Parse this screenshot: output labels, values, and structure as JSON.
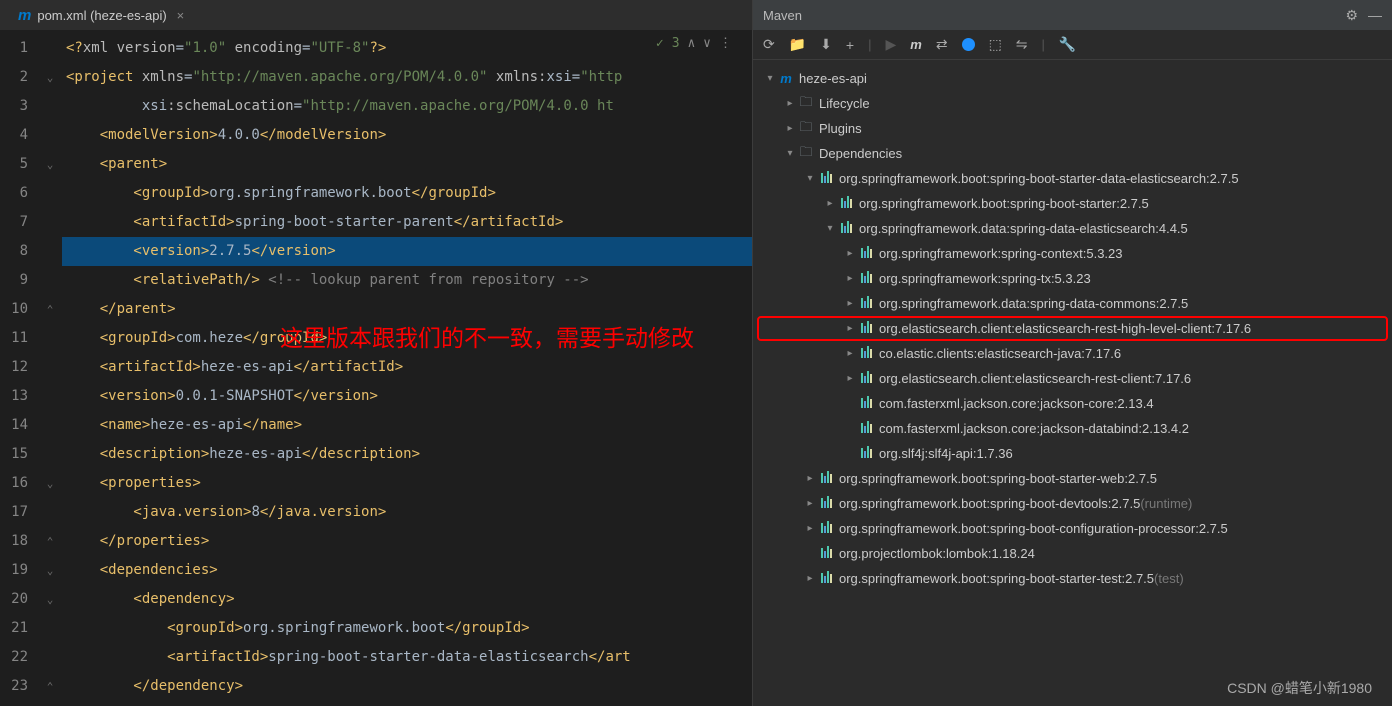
{
  "tab": {
    "icon": "m",
    "title": "pom.xml (heze-es-api)"
  },
  "analysisStatus": {
    "check": "✓",
    "count": "3",
    "arrows": "∧ ∨"
  },
  "annotation": "这里版本跟我们的不一致，需要手动修改",
  "watermark": "CSDN @蜡笔小新1980",
  "codeLines": [
    {
      "n": "1",
      "content": [
        {
          "t": "<?",
          "c": "c-punct"
        },
        {
          "t": "xml version",
          "c": "c-attr"
        },
        {
          "t": "=",
          "c": "c-txt"
        },
        {
          "t": "\"1.0\"",
          "c": "c-str"
        },
        {
          "t": " encoding",
          "c": "c-attr"
        },
        {
          "t": "=",
          "c": "c-txt"
        },
        {
          "t": "\"UTF-8\"",
          "c": "c-str"
        },
        {
          "t": "?>",
          "c": "c-punct"
        }
      ]
    },
    {
      "n": "2",
      "content": [
        {
          "t": "<project ",
          "c": "c-tag"
        },
        {
          "t": "xmlns",
          "c": "c-attr"
        },
        {
          "t": "=",
          "c": "c-txt"
        },
        {
          "t": "\"http://maven.apache.org/POM/4.0.0\"",
          "c": "c-str"
        },
        {
          "t": " xmlns:",
          "c": "c-attr"
        },
        {
          "t": "xsi",
          "c": "c-txt"
        },
        {
          "t": "=",
          "c": "c-txt"
        },
        {
          "t": "\"http",
          "c": "c-str"
        }
      ]
    },
    {
      "n": "3",
      "content": [
        {
          "t": "         xsi",
          "c": "c-txt"
        },
        {
          "t": ":schemaLocation",
          "c": "c-attr"
        },
        {
          "t": "=",
          "c": "c-txt"
        },
        {
          "t": "\"http://maven.apache.org/POM/4.0.0 ht",
          "c": "c-str"
        }
      ]
    },
    {
      "n": "4",
      "content": [
        {
          "t": "    <modelVersion>",
          "c": "c-tag"
        },
        {
          "t": "4.0.0",
          "c": "c-txt"
        },
        {
          "t": "</modelVersion>",
          "c": "c-tag"
        }
      ]
    },
    {
      "n": "5",
      "content": [
        {
          "t": "    <parent>",
          "c": "c-tag"
        }
      ]
    },
    {
      "n": "6",
      "content": [
        {
          "t": "        <groupId>",
          "c": "c-tag"
        },
        {
          "t": "org.springframework.boot",
          "c": "c-txt"
        },
        {
          "t": "</groupId>",
          "c": "c-tag"
        }
      ]
    },
    {
      "n": "7",
      "content": [
        {
          "t": "        <artifactId>",
          "c": "c-tag"
        },
        {
          "t": "spring-boot-starter-parent",
          "c": "c-txt"
        },
        {
          "t": "</artifactId>",
          "c": "c-tag"
        }
      ]
    },
    {
      "n": "8",
      "hl": true,
      "content": [
        {
          "t": "        <version>",
          "c": "c-tag"
        },
        {
          "t": "2.7.5",
          "c": "c-txt"
        },
        {
          "t": "</version>",
          "c": "c-tag"
        }
      ]
    },
    {
      "n": "9",
      "content": [
        {
          "t": "        <relativePath/> ",
          "c": "c-tag"
        },
        {
          "t": "<!-- lookup parent from repository -->",
          "c": "c-comment"
        }
      ]
    },
    {
      "n": "10",
      "content": [
        {
          "t": "    </parent>",
          "c": "c-tag"
        }
      ]
    },
    {
      "n": "11",
      "content": [
        {
          "t": "    <groupId>",
          "c": "c-tag"
        },
        {
          "t": "com.heze",
          "c": "c-txt"
        },
        {
          "t": "</groupId>",
          "c": "c-tag"
        }
      ]
    },
    {
      "n": "12",
      "content": [
        {
          "t": "    <artifactId>",
          "c": "c-tag"
        },
        {
          "t": "heze-es-api",
          "c": "c-txt"
        },
        {
          "t": "</artifactId>",
          "c": "c-tag"
        }
      ]
    },
    {
      "n": "13",
      "content": [
        {
          "t": "    <version>",
          "c": "c-tag"
        },
        {
          "t": "0.0.1-SNAPSHOT",
          "c": "c-txt"
        },
        {
          "t": "</version>",
          "c": "c-tag"
        }
      ]
    },
    {
      "n": "14",
      "content": [
        {
          "t": "    <name>",
          "c": "c-tag"
        },
        {
          "t": "heze-es-api",
          "c": "c-txt"
        },
        {
          "t": "</name>",
          "c": "c-tag"
        }
      ]
    },
    {
      "n": "15",
      "content": [
        {
          "t": "    <description>",
          "c": "c-tag"
        },
        {
          "t": "heze-es-api",
          "c": "c-txt"
        },
        {
          "t": "</description>",
          "c": "c-tag"
        }
      ]
    },
    {
      "n": "16",
      "content": [
        {
          "t": "    <properties>",
          "c": "c-tag"
        }
      ]
    },
    {
      "n": "17",
      "content": [
        {
          "t": "        <java.version>",
          "c": "c-tag"
        },
        {
          "t": "8",
          "c": "c-txt"
        },
        {
          "t": "</java.version>",
          "c": "c-tag"
        }
      ]
    },
    {
      "n": "18",
      "content": [
        {
          "t": "    </properties>",
          "c": "c-tag"
        }
      ]
    },
    {
      "n": "19",
      "content": [
        {
          "t": "    <dependencies>",
          "c": "c-tag"
        }
      ]
    },
    {
      "n": "20",
      "content": [
        {
          "t": "        <dependency>",
          "c": "c-tag"
        }
      ]
    },
    {
      "n": "21",
      "content": [
        {
          "t": "            <groupId>",
          "c": "c-tag"
        },
        {
          "t": "org.springframework.boot",
          "c": "c-txt"
        },
        {
          "t": "</groupId>",
          "c": "c-tag"
        }
      ]
    },
    {
      "n": "22",
      "content": [
        {
          "t": "            <artifactId>",
          "c": "c-tag"
        },
        {
          "t": "spring-boot-starter-data-elasticsearch",
          "c": "c-txt"
        },
        {
          "t": "</art",
          "c": "c-tag"
        }
      ]
    },
    {
      "n": "23",
      "content": [
        {
          "t": "        </dependency>",
          "c": "c-tag"
        }
      ]
    }
  ],
  "maven": {
    "title": "Maven",
    "tree": [
      {
        "indent": 0,
        "caret": "▾",
        "icon": "m",
        "label": "heze-es-api"
      },
      {
        "indent": 1,
        "caret": "▸",
        "icon": "folder",
        "label": "Lifecycle"
      },
      {
        "indent": 1,
        "caret": "▸",
        "icon": "folder",
        "label": "Plugins"
      },
      {
        "indent": 1,
        "caret": "▾",
        "icon": "folder",
        "label": "Dependencies"
      },
      {
        "indent": 2,
        "caret": "▾",
        "icon": "dep",
        "label": "org.springframework.boot:spring-boot-starter-data-elasticsearch:2.7.5"
      },
      {
        "indent": 3,
        "caret": "▸",
        "icon": "dep",
        "label": "org.springframework.boot:spring-boot-starter:2.7.5"
      },
      {
        "indent": 3,
        "caret": "▾",
        "icon": "dep",
        "label": "org.springframework.data:spring-data-elasticsearch:4.4.5"
      },
      {
        "indent": 4,
        "caret": "▸",
        "icon": "dep",
        "label": "org.springframework:spring-context:5.3.23"
      },
      {
        "indent": 4,
        "caret": "▸",
        "icon": "dep",
        "label": "org.springframework:spring-tx:5.3.23"
      },
      {
        "indent": 4,
        "caret": "▸",
        "icon": "dep",
        "label": "org.springframework.data:spring-data-commons:2.7.5"
      },
      {
        "indent": 4,
        "caret": "▸",
        "icon": "dep",
        "label": "org.elasticsearch.client:elasticsearch-rest-high-level-client:7.17.6",
        "hl": true
      },
      {
        "indent": 4,
        "caret": "▸",
        "icon": "dep",
        "label": "co.elastic.clients:elasticsearch-java:7.17.6"
      },
      {
        "indent": 4,
        "caret": "▸",
        "icon": "dep",
        "label": "org.elasticsearch.client:elasticsearch-rest-client:7.17.6"
      },
      {
        "indent": 4,
        "caret": "",
        "icon": "dep",
        "label": "com.fasterxml.jackson.core:jackson-core:2.13.4"
      },
      {
        "indent": 4,
        "caret": "",
        "icon": "dep",
        "label": "com.fasterxml.jackson.core:jackson-databind:2.13.4.2"
      },
      {
        "indent": 4,
        "caret": "",
        "icon": "dep",
        "label": "org.slf4j:slf4j-api:1.7.36"
      },
      {
        "indent": 2,
        "caret": "▸",
        "icon": "dep",
        "label": "org.springframework.boot:spring-boot-starter-web:2.7.5"
      },
      {
        "indent": 2,
        "caret": "▸",
        "icon": "dep",
        "label": "org.springframework.boot:spring-boot-devtools:2.7.5",
        "suffix": " (runtime)"
      },
      {
        "indent": 2,
        "caret": "▸",
        "icon": "dep",
        "label": "org.springframework.boot:spring-boot-configuration-processor:2.7.5"
      },
      {
        "indent": 2,
        "caret": "",
        "icon": "dep",
        "label": "org.projectlombok:lombok:1.18.24"
      },
      {
        "indent": 2,
        "caret": "▸",
        "icon": "dep",
        "label": "org.springframework.boot:spring-boot-starter-test:2.7.5",
        "suffix": " (test)"
      }
    ]
  }
}
